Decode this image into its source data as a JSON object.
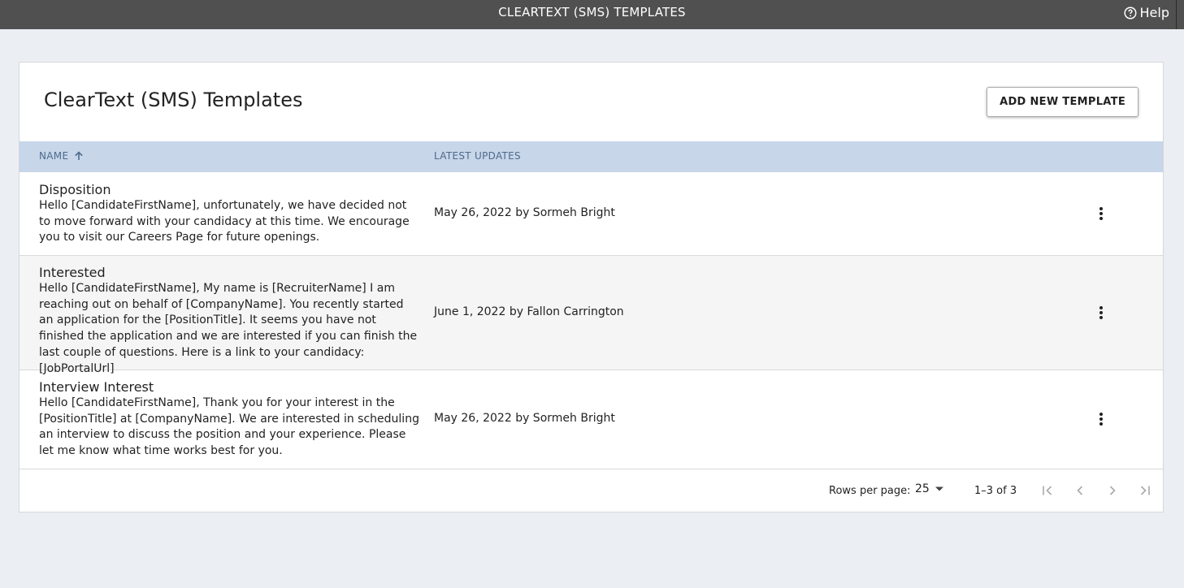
{
  "topbar": {
    "title": "CLEARTEXT (SMS) TEMPLATES",
    "help_label": "Help"
  },
  "page": {
    "title": "ClearText (SMS) Templates",
    "add_button_label": "ADD NEW TEMPLATE"
  },
  "table": {
    "columns": {
      "name": "NAME",
      "latest_updates": "LATEST UPDATES"
    },
    "sort": {
      "column": "name",
      "direction": "ascending"
    },
    "rows": [
      {
        "name": "Disposition",
        "description": "Hello [CandidateFirstName], unfortunately, we have decided not to move forward with your candidacy at this time. We encourage you to visit our Careers Page for future openings.",
        "updated": "May 26, 2022 by Sormeh Bright"
      },
      {
        "name": "Interested",
        "description": "Hello [CandidateFirstName], My name is [RecruiterName] I am reaching out on behalf of [CompanyName]. You recently started an application for the [PositionTitle]. It seems you have not finished the application and we are interested if you can finish the last couple of questions. Here is a link to your candidacy: [JobPortalUrl]",
        "updated": "June 1, 2022 by Fallon Carrington"
      },
      {
        "name": "Interview Interest",
        "description": "Hello [CandidateFirstName], Thank you for your interest in the [PositionTitle] at [CompanyName]. We are interested in scheduling an interview to discuss the position and your experience. Please let me know what time works best for you.",
        "updated": "May 26, 2022 by Sormeh Bright"
      }
    ]
  },
  "pagination": {
    "rows_per_page_label": "Rows per page:",
    "rows_per_page_value": "25",
    "range_text": "1–3 of 3"
  },
  "icons": {
    "help": "help-circle-icon",
    "sort": "arrow-up-icon",
    "row_menu": "more-vertical-icon",
    "dropdown": "caret-down-icon",
    "first_page": "first-page-icon",
    "prev_page": "chevron-left-icon",
    "next_page": "chevron-right-icon",
    "last_page": "last-page-icon"
  },
  "colors": {
    "topbar_bg": "#505050",
    "page_bg": "#ebeef3",
    "table_header_bg": "#c7d6e9",
    "table_header_text": "#4d6a8c",
    "alt_row_bg": "#f5f5f5"
  }
}
